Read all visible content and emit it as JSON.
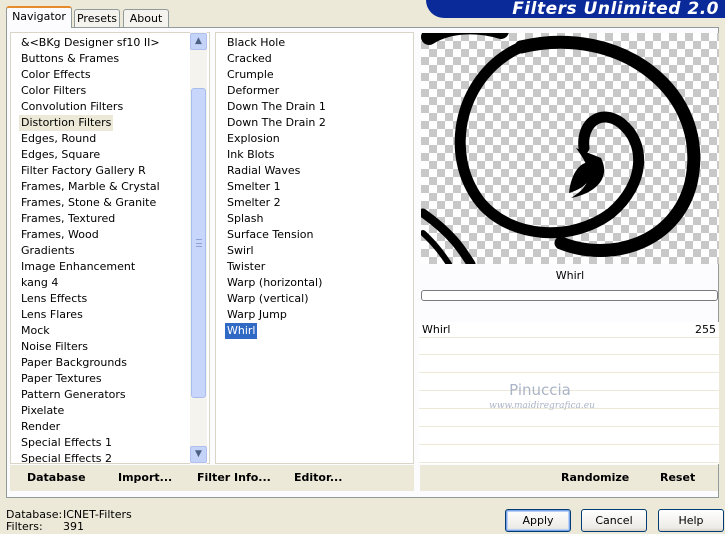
{
  "title": "Filters Unlimited 2.0",
  "tabs": [
    {
      "label": "Navigator",
      "active": true
    },
    {
      "label": "Presets",
      "active": false
    },
    {
      "label": "About",
      "active": false
    }
  ],
  "categories": [
    "&<BKg Designer sf10 II>",
    "Buttons & Frames",
    "Color Effects",
    "Color Filters",
    "Convolution Filters",
    "Distortion Filters",
    "Edges, Round",
    "Edges, Square",
    "Filter Factory Gallery R",
    "Frames, Marble & Crystal",
    "Frames, Stone & Granite",
    "Frames, Textured",
    "Frames, Wood",
    "Gradients",
    "Image Enhancement",
    "kang 4",
    "Lens Effects",
    "Lens Flares",
    "Mock",
    "Noise Filters",
    "Paper Backgrounds",
    "Paper Textures",
    "Pattern Generators",
    "Pixelate",
    "Render",
    "Special Effects 1",
    "Special Effects 2"
  ],
  "selected_category": "Distortion Filters",
  "filters": [
    "Black Hole",
    "Cracked",
    "Crumple",
    "Deformer",
    "Down The Drain 1",
    "Down The Drain 2",
    "Explosion",
    "Ink Blots",
    "Radial Waves",
    "Smelter 1",
    "Smelter 2",
    "Splash",
    "Surface Tension",
    "Swirl",
    "Twister",
    "Warp (horizontal)",
    "Warp (vertical)",
    "Warp Jump",
    "Whirl"
  ],
  "selected_filter": "Whirl",
  "preview_filter_name": "Whirl",
  "params": [
    {
      "name": "Whirl",
      "value": "255"
    }
  ],
  "watermark": {
    "name": "Pinuccia",
    "site": "www.maidiregrafica.eu"
  },
  "left_buttons": {
    "database": "Database",
    "import": "Import...",
    "filter_info": "Filter Info...",
    "editor": "Editor..."
  },
  "right_buttons": {
    "randomize": "Randomize",
    "reset": "Reset"
  },
  "status": {
    "database_label": "Database:",
    "database_value": "ICNET-Filters",
    "filters_label": "Filters:",
    "filters_value": "391"
  },
  "dialog_buttons": {
    "apply": "Apply",
    "cancel": "Cancel",
    "help": "Help"
  },
  "colors": {
    "selection": "#316ac5",
    "banner": "#0a2a9a",
    "window_bg": "#ece9d8"
  }
}
